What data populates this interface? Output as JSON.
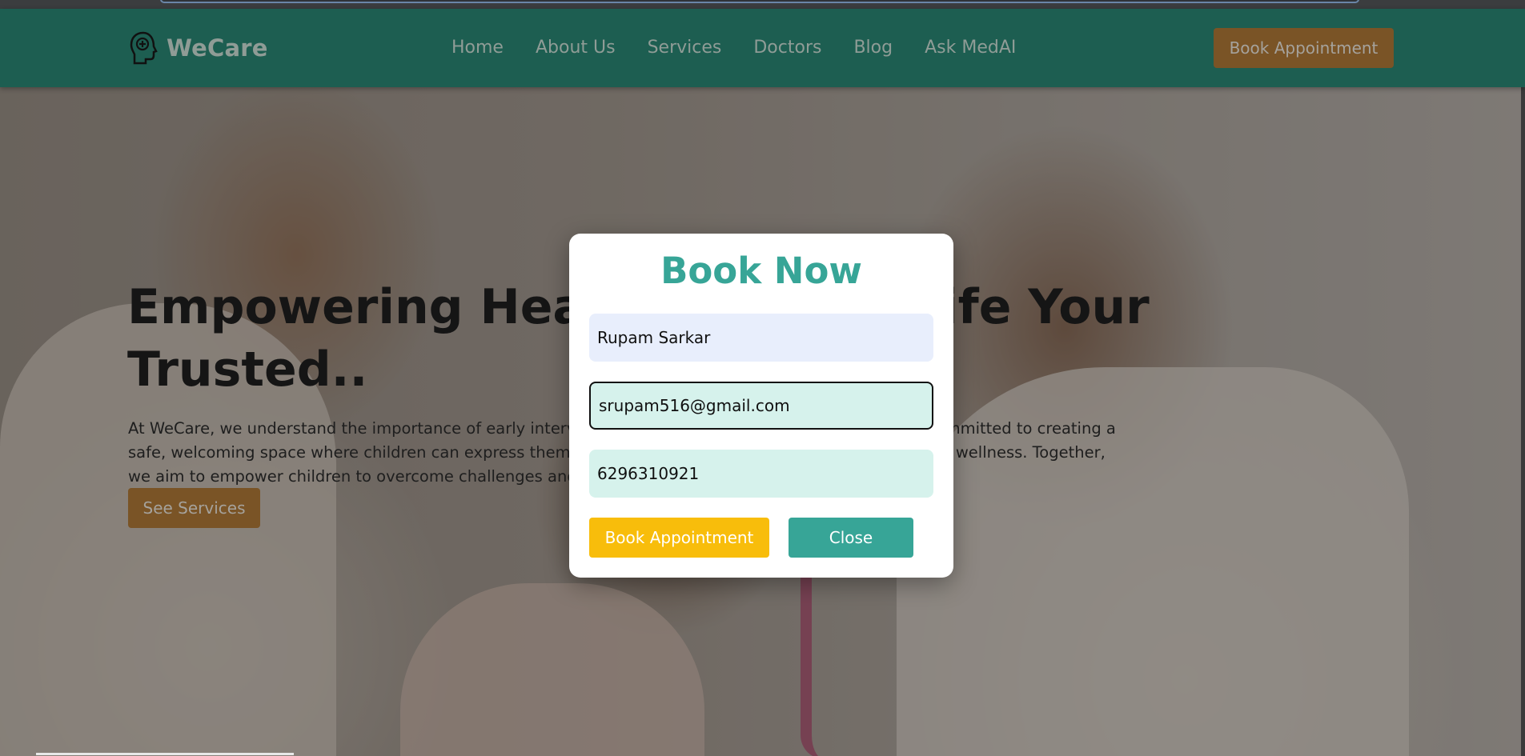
{
  "brand": {
    "name": "WeCare",
    "logo_icon": "head-with-plus-icon"
  },
  "nav": {
    "links": [
      "Home",
      "About Us",
      "Services",
      "Doctors",
      "Blog",
      "Ask MedAI"
    ],
    "cta_label": "Book Appointment"
  },
  "hero": {
    "title": "Empowering Health, Vibrant Life Your Trusted..",
    "paragraph": "At WeCare, we understand the importance of early intervention and support in mental health. We are committed to creating a safe, welcoming space where children can express themselves freely and get help to build strong mental wellness. Together, we aim to empower children to overcome challenges and grow into healthy, happy individuals.",
    "button_label": "See Services"
  },
  "modal": {
    "title": "Book Now",
    "name_value": "Rupam Sarkar",
    "email_value": "srupam516@gmail.com",
    "phone_value": "6296310921",
    "book_label": "Book Appointment",
    "close_label": "Close"
  },
  "colors": {
    "nav_bg": "#1d5e51",
    "accent_teal": "#37a597",
    "accent_brown": "#7a5426",
    "accent_yellow": "#f8bd0b"
  }
}
